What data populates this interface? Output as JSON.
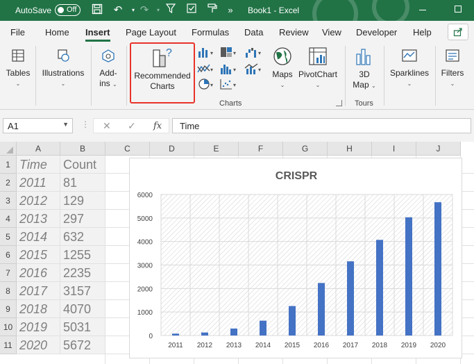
{
  "titlebar": {
    "autosave_label": "AutoSave",
    "autosave_state": "Off",
    "book_title": "Book1  -  Excel"
  },
  "menu": {
    "tabs": [
      "File",
      "Home",
      "Insert",
      "Page Layout",
      "Formulas",
      "Data",
      "Review",
      "View",
      "Developer",
      "Help"
    ],
    "active_tab": "Insert"
  },
  "ribbon": {
    "tables_label": "Tables",
    "illustrations_label": "Illustrations",
    "addins_label_1": "Add-",
    "addins_label_2": "ins",
    "recommended_label_1": "Recommended",
    "recommended_label_2": "Charts",
    "charts_group_label": "Charts",
    "maps_label": "Maps",
    "pivotchart_label": "PivotChart",
    "map3d_label_1": "3D",
    "map3d_label_2": "Map",
    "tours_group_label": "Tours",
    "sparklines_label": "Sparklines",
    "filters_label": "Filters"
  },
  "formula_bar": {
    "name_box": "A1",
    "fx_symbol": "fx",
    "content": "Time"
  },
  "sheet": {
    "columns": [
      "A",
      "B",
      "C",
      "D",
      "E",
      "F",
      "G",
      "H",
      "I",
      "J"
    ],
    "rows": [
      "1",
      "2",
      "3",
      "4",
      "5",
      "6",
      "7",
      "8",
      "9",
      "10",
      "11"
    ],
    "header_time": "Time",
    "header_count": "Count",
    "data": [
      {
        "year": "2011",
        "count": "81"
      },
      {
        "year": "2012",
        "count": "129"
      },
      {
        "year": "2013",
        "count": "297"
      },
      {
        "year": "2014",
        "count": "632"
      },
      {
        "year": "2015",
        "count": "1255"
      },
      {
        "year": "2016",
        "count": "2235"
      },
      {
        "year": "2017",
        "count": "3157"
      },
      {
        "year": "2018",
        "count": "4070"
      },
      {
        "year": "2019",
        "count": "5031"
      },
      {
        "year": "2020",
        "count": "5672"
      }
    ]
  },
  "colors": {
    "excel_green": "#217346",
    "bar": "#4472c4",
    "highlight": "#e8332a"
  },
  "chart_data": {
    "type": "bar",
    "title": "CRISPR",
    "categories": [
      "2011",
      "2012",
      "2013",
      "2014",
      "2015",
      "2016",
      "2017",
      "2018",
      "2019",
      "2020"
    ],
    "values": [
      81,
      129,
      297,
      632,
      1255,
      2235,
      3157,
      4070,
      5031,
      5672
    ],
    "yticks": [
      "0",
      "1000",
      "2000",
      "3000",
      "4000",
      "5000",
      "6000"
    ],
    "ylim": [
      0,
      6000
    ],
    "grid": true,
    "legend": "none"
  }
}
